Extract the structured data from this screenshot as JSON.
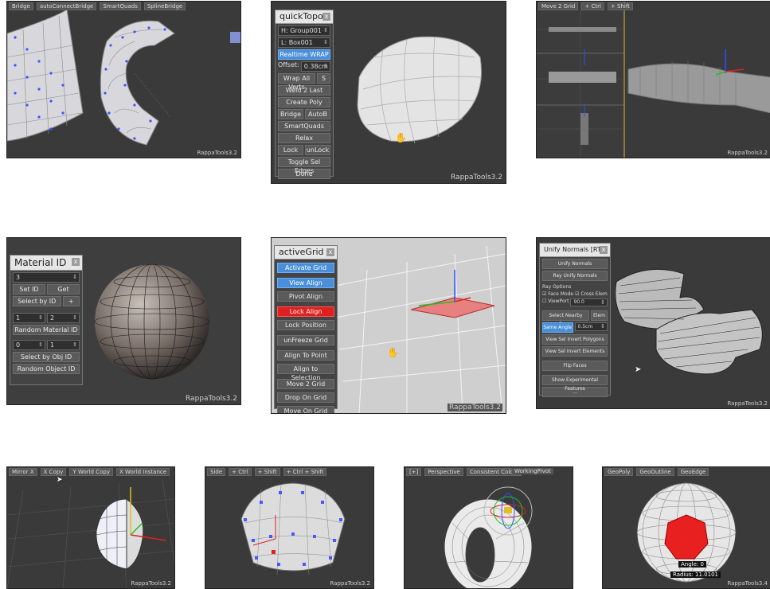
{
  "watermarks": {
    "v32": "RappaTools3.2",
    "v34": "RappaTools3.4"
  },
  "tile1": {
    "tabs": [
      "Bridge",
      "autoConnectBridge",
      "SmartQuads",
      "SplineBridge"
    ]
  },
  "quickTopo": {
    "title": "quickTopo",
    "close": "x",
    "h_value": "H: Group001",
    "l_value": "L: Box001",
    "realtime": "Realtime WRAP",
    "offset_label": "Offset:",
    "offset_value": "0.38cm",
    "wrap_all": "Wrap All Verts",
    "wrap_s": "S",
    "weld": "Weld 2 Last",
    "create_poly": "Create Poly",
    "bridge": "Bridge",
    "autob": "AutoB",
    "smartquads": "SmartQuads",
    "relax": "Relax",
    "lock": "Lock",
    "unlock": "unLock",
    "toggle": "Toggle Sel Edges",
    "done": "Done"
  },
  "tile3": {
    "tabs": [
      "Move 2 Grid",
      "+ Ctrl",
      "+ Shift"
    ]
  },
  "materialID": {
    "title": "Material ID",
    "close": "x",
    "id_value": "3",
    "set_id": "Set ID",
    "get": "Get",
    "select_by_id": "Select by ID",
    "plus": "+",
    "range_from": "1",
    "range_to": "2",
    "random_material": "Random Material ID",
    "obj_from": "0",
    "obj_to": "1",
    "select_by_obj": "Select by Obj ID",
    "random_object": "Random Object ID"
  },
  "activeGrid": {
    "title": "activeGrid",
    "close": "x",
    "buttons": [
      "Activate Grid",
      "View Align",
      "Pivot Align",
      "Lock Align",
      "Lock Position",
      "unFreeze Grid",
      "Align To Point",
      "Align to Selection",
      "Move 2 Grid",
      "Drop On Grid",
      "Move On Grid"
    ]
  },
  "unifyNormals": {
    "title": "Unify Normals [RT3]",
    "close": "x",
    "unify": "Unify Normals",
    "ray_unify": "Ray Unify Normals",
    "ray_options": "Ray Options",
    "face_mode": "Face Mode",
    "cross_elem": "Cross Elem",
    "viewport": "ViewPort",
    "vp_value": "90.0",
    "select_nearby": "Select Nearby Faces",
    "elem": "Elem",
    "same_angle": "Same Angle",
    "angle_value": "0.5cm",
    "view_sel_inv_poly": "View Sel Invert Polygons",
    "view_sel_inv_elem": "View Sel Invert Elements",
    "flip_faces": "Flip Faces",
    "show_exp": "Show Experimental Features",
    "dots": "..."
  },
  "tile7": {
    "tabs": [
      "Mirror X",
      "X Copy",
      "Y World Copy",
      "X World Instance"
    ]
  },
  "tile8": {
    "tabs": [
      "Side",
      "+ Ctrl",
      "+ Shift",
      "+ Ctrl + Shift"
    ]
  },
  "tile9": {
    "tabs": [
      "[+]",
      "Perspective",
      "Consistent Colors"
    ],
    "label": "WorkingPivot"
  },
  "tile10": {
    "tabs": [
      "GeoPoly",
      "GeoOutline",
      "GeoEdge"
    ],
    "angle": "Angle: 0",
    "radius": "Radius: 11.0101"
  }
}
